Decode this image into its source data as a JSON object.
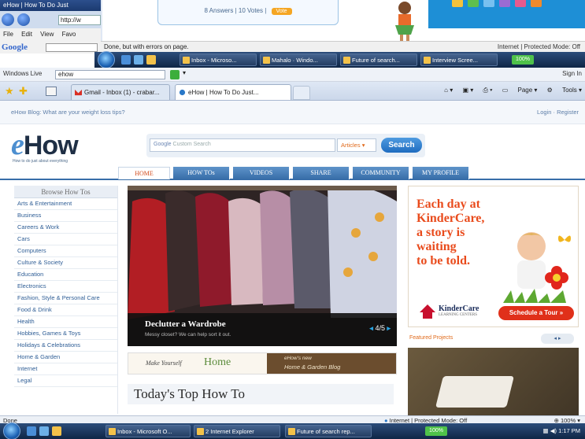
{
  "background_window": {
    "title": "eHow | How To Do Just",
    "address": "http://w",
    "answers_text": "8 Answers | 10 Votes |",
    "answers_button": "Vote",
    "menu": [
      "File",
      "Edit",
      "View",
      "Favo"
    ],
    "google_logo": "Google",
    "status_text": "Done, but with errors on page.",
    "status_zone": "Internet | Protected Mode: Off",
    "taskbar": {
      "items": [
        "Inbox - Microso...",
        "Mahalo · Windo...",
        "Future of search...",
        "Interview Scree..."
      ],
      "battery_pct": "100%"
    }
  },
  "windows_live": {
    "label": "Windows Live",
    "search_value": "ehow",
    "sign_in": "Sign In"
  },
  "tabs": [
    {
      "label": "Gmail - Inbox (1) - crabar..."
    },
    {
      "label": "eHow | How To Do Just..."
    }
  ],
  "command_bar": {
    "page": "Page",
    "tools": "Tools"
  },
  "ehow": {
    "blog_link": "eHow Blog: What are your weight loss tips?",
    "login_register": "Login · Register",
    "logo_e": "e",
    "logo_how": "How",
    "tagline": "How to do just about everything",
    "search_placeholder": "Custom Search",
    "search_google": "Google",
    "search_scope": "Articles",
    "search_button": "Search",
    "nav": [
      "HOME",
      "HOW TOs",
      "VIDEOS",
      "SHARE",
      "COMMUNITY",
      "MY PROFILE"
    ],
    "sidebar": {
      "heading": "Browse How Tos",
      "items": [
        "Arts & Entertainment",
        "Business",
        "Careers & Work",
        "Cars",
        "Computers",
        "Culture & Society",
        "Education",
        "Electronics",
        "Fashion, Style & Personal Care",
        "Food & Drink",
        "Health",
        "Hobbies, Games & Toys",
        "Holidays & Celebrations",
        "Home & Garden",
        "Internet",
        "Legal"
      ]
    },
    "hero": {
      "title": "Declutter a Wardrobe",
      "subtitle": "Messy closet? We can help sort it out.",
      "pager": "4/5"
    },
    "banner": {
      "left_script": "Make Yourself",
      "left_word": "Home",
      "right_line1": "eHow's new",
      "right_line2": "Home & Garden Blog"
    },
    "today_heading": "Today's Top How To",
    "ad": {
      "text_lines": [
        "Each day at",
        "KinderCare,",
        "a story is",
        "waiting",
        "to be told."
      ],
      "brand": "KinderCare",
      "brand_sub": "LEARNING CENTERS",
      "cta": "Schedule a Tour »"
    },
    "featured": {
      "label": "Featured Projects",
      "nav": "◂  ▸"
    }
  },
  "status_bar": {
    "left": "Done",
    "zone": "Internet | Protected Mode: Off",
    "zoom": "100%"
  },
  "taskbar": {
    "items": [
      "Inbox - Microsoft O...",
      "2 Internet Explorer",
      "Future of search rep..."
    ],
    "battery_pct": "100%",
    "clock": "1:17 PM"
  },
  "colors": {
    "ehow_blue": "#4d8fd0",
    "nav_blue": "#376da8",
    "accent_orange": "#e06a1b",
    "ad_red": "#e94b1c"
  }
}
